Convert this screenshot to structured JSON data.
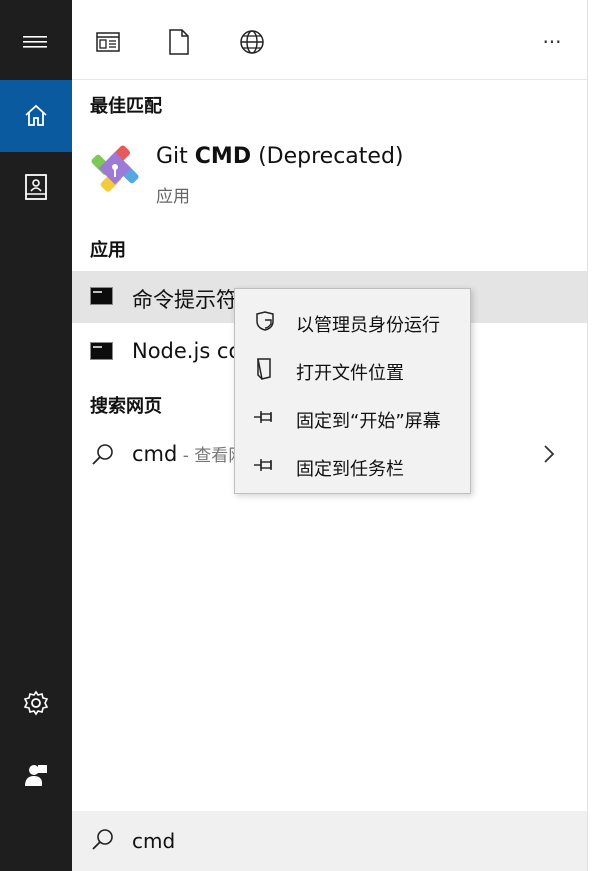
{
  "rail": {
    "items": [
      {
        "name": "menu",
        "icon": "hamburger-icon"
      },
      {
        "name": "home",
        "icon": "home-icon",
        "active": true
      },
      {
        "name": "documents",
        "icon": "notebook-icon"
      },
      {
        "name": "settings",
        "icon": "gear-icon"
      },
      {
        "name": "user",
        "icon": "person-icon"
      }
    ]
  },
  "topbar": {
    "icons": [
      "apps-filter-icon",
      "documents-filter-icon",
      "web-filter-icon",
      "more-icon"
    ],
    "more_label": "···"
  },
  "best_match": {
    "header": "最佳匹配",
    "app_name_prefix": "Git ",
    "app_name_bold": "CMD",
    "app_name_suffix": " (Deprecated)",
    "app_type": "应用"
  },
  "apps": {
    "header": "应用",
    "items": [
      {
        "label": "命令提示符",
        "icon": "cmd-icon"
      },
      {
        "label": "Node.js command prompt",
        "icon": "cmd-icon"
      }
    ]
  },
  "web": {
    "header": "搜索网页",
    "query": "cmd",
    "suffix": " - 查看网络搜索结果"
  },
  "search": {
    "value": "cmd"
  },
  "context_menu": {
    "items": [
      {
        "label": "以管理员身份运行",
        "icon": "shield-icon"
      },
      {
        "label": "打开文件位置",
        "icon": "folder-location-icon"
      },
      {
        "label": "固定到“开始”屏幕",
        "icon": "pin-icon"
      },
      {
        "label": "固定到任务栏",
        "icon": "pin-icon"
      }
    ]
  },
  "colors": {
    "rail_bg": "#1e1e1e",
    "accent": "#0a5aa0",
    "hover_bg": "#e4e4e4",
    "search_bg": "#f0f0f0"
  }
}
